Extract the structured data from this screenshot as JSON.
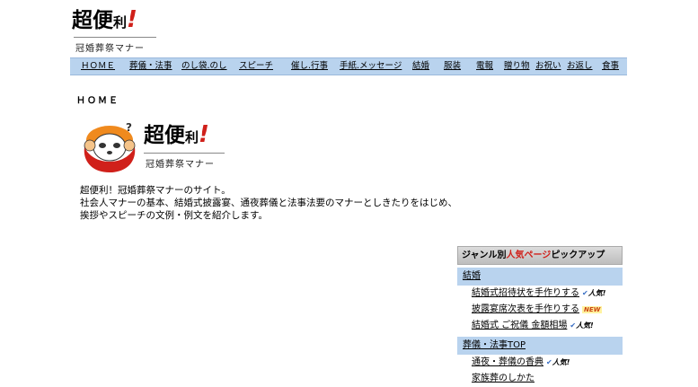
{
  "logo": {
    "title_main": "超便",
    "title_small": "利",
    "title_bang": "!",
    "subtitle": "冠婚葬祭マナー"
  },
  "nav": {
    "items": [
      {
        "label": "ＨＯＭＥ"
      },
      {
        "label": "葬儀・法事"
      },
      {
        "label": "のし袋.のし"
      },
      {
        "label": "スピーチ"
      },
      {
        "label": "催し.行事"
      },
      {
        "label": "手紙.メッセージ"
      },
      {
        "label": "結婚"
      },
      {
        "label": "服装"
      },
      {
        "label": "電報"
      },
      {
        "label": "贈り物"
      },
      {
        "label": "お祝い"
      },
      {
        "label": "お返し"
      },
      {
        "label": "食事"
      }
    ]
  },
  "breadcrumb": "ＨＯＭＥ",
  "mascot_logo": {
    "title_main": "超便",
    "title_small": "利",
    "title_bang": "!",
    "subtitle": "冠婚葬祭マナー"
  },
  "intro": {
    "line1": "超便利！冠婚葬祭マナーのサイト。",
    "line2": "社会人マナーの基本、結婚式披露宴、通夜葬儀と法事法要のマナーとしきたりをはじめ、挨拶やスピーチの文例・例文を紹介します。"
  },
  "sidebar": {
    "header_prefix": "ジャンル別",
    "header_highlight": "人気ページ",
    "header_suffix": "ピックアップ",
    "sections": [
      {
        "title": "結婚",
        "items": [
          {
            "label": "結婚式招待状を手作りする",
            "badge": "人気!"
          },
          {
            "label": "披露宴席次表を手作りする",
            "badge_new": "NEW"
          },
          {
            "label": "結婚式 ご祝儀 金額相場",
            "badge": "人気!"
          }
        ]
      },
      {
        "title": "葬儀・法事TOP",
        "items": [
          {
            "label": "通夜・葬儀の香典",
            "badge": "人気!"
          },
          {
            "label": "家族葬のしかた"
          }
        ]
      }
    ]
  },
  "colors": {
    "nav_bg": "#b9d3ee",
    "accent_red": "#d0201a"
  }
}
